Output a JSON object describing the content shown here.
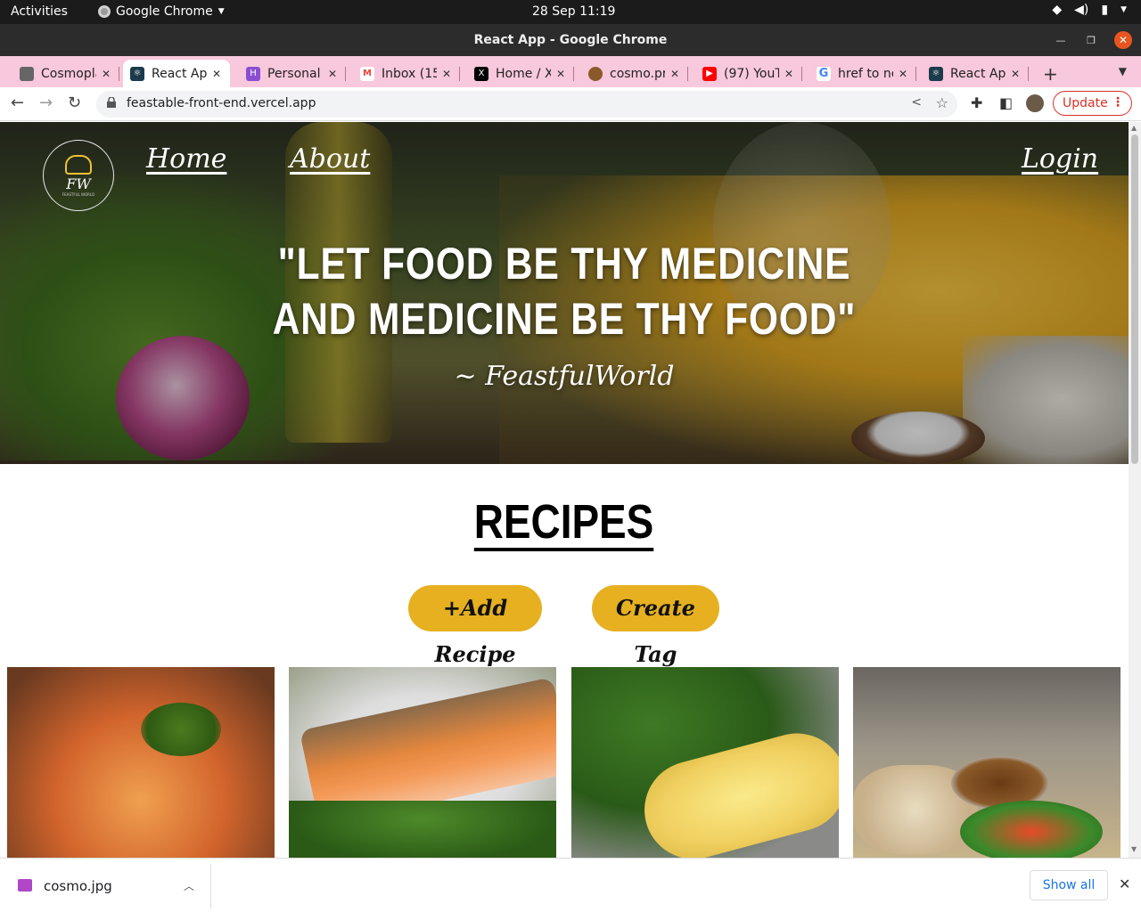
{
  "os": {
    "activities": "Activities",
    "app_name": "Google Chrome",
    "clock": "28 Sep  11:19"
  },
  "window": {
    "title": "React App - Google Chrome"
  },
  "tabs": [
    {
      "label": "Cosmopla",
      "favicon": "cosmo-icon",
      "color": "#666666"
    },
    {
      "label": "React App",
      "favicon": "react-icon",
      "color": "#1b3a4b",
      "active": true
    },
    {
      "label": "Personal",
      "favicon": "hackmd-icon",
      "color": "#8a4fd0"
    },
    {
      "label": "Inbox (15",
      "favicon": "gmail-icon",
      "color": "#ea4335"
    },
    {
      "label": "Home / X",
      "favicon": "x-icon",
      "color": "#000000"
    },
    {
      "label": "cosmo.pr",
      "favicon": "cosmo-pr-icon",
      "color": "#8a5a2a"
    },
    {
      "label": "(97) YouT",
      "favicon": "youtube-icon",
      "color": "#ff0000"
    },
    {
      "label": "href to ne",
      "favicon": "google-icon",
      "color": "#4285f4"
    },
    {
      "label": "React App",
      "favicon": "react-icon",
      "color": "#1b3a4b"
    }
  ],
  "toolbar": {
    "url": "feastable-front-end.vercel.app",
    "update_label": "Update"
  },
  "page": {
    "nav": {
      "home": "Home",
      "about": "About",
      "login": "Login"
    },
    "logo": {
      "monogram": "FW",
      "subtitle": "FEASTFUL WORLD"
    },
    "hero": {
      "quote_line1": "\"LET FOOD BE THY MEDICINE",
      "quote_line2": "AND MEDICINE BE THY FOOD\"",
      "attribution": "~ FeastfulWorld"
    },
    "section_title": "RECIPES",
    "buttons": {
      "add_recipe": "+Add Recipe",
      "create_tag": "Create Tag"
    },
    "accent_color": "#e6b020"
  },
  "downloads": {
    "file_name": "cosmo.jpg",
    "show_all": "Show all"
  }
}
